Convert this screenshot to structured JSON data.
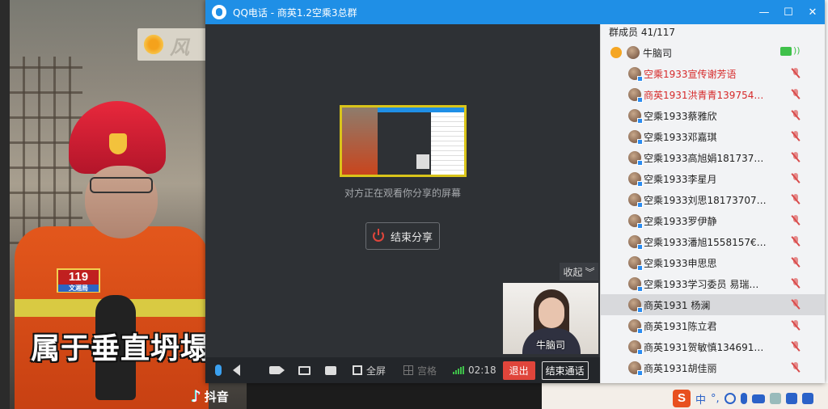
{
  "background_video": {
    "subtitle": "属于垂直坍塌",
    "patch_number": "119",
    "patch_sub": "文湘局",
    "app_name": "抖音"
  },
  "window": {
    "title": "QQ电话 - 商英1.2空乘3总群",
    "controls": [
      "minimize",
      "maximize",
      "close"
    ]
  },
  "share": {
    "status_text": "对方正在观看你分享的屏幕",
    "end_share_label": "结束分享",
    "collapse_label": "收起",
    "pip_name": "牛脑司"
  },
  "toolbar": {
    "fullscreen_label": "全屏",
    "grid_label": "宫格",
    "timer": "02:18",
    "exit_label": "退出",
    "end_call_label": "结束通话"
  },
  "members": {
    "header": "群成员 41/117",
    "me": {
      "name": "牛脑司"
    },
    "list": [
      {
        "name": "空乘1933宣传谢芳语",
        "red": true
      },
      {
        "name": "商英1931洪青青139754…",
        "red": true
      },
      {
        "name": "空乘1933蔡雅欣",
        "red": false
      },
      {
        "name": "空乘1933邓嘉琪",
        "red": false
      },
      {
        "name": "空乘1933高旭娟181737…",
        "red": false
      },
      {
        "name": "空乘1933李星月",
        "red": false
      },
      {
        "name": "空乘1933刘思18173707…",
        "red": false
      },
      {
        "name": "空乘1933罗伊静",
        "red": false
      },
      {
        "name": "空乘1933潘旭1558157€…",
        "red": false
      },
      {
        "name": "空乘1933申思思",
        "red": false
      },
      {
        "name": "空乘1933学习委员 易瑞…",
        "red": false
      },
      {
        "name": "商英1931 杨澜",
        "red": false,
        "selected": true
      },
      {
        "name": "商英1931陈立君",
        "red": false
      },
      {
        "name": "商英1931贺敏慎134691…",
        "red": false
      },
      {
        "name": "商英1931胡佳丽",
        "red": false
      }
    ]
  },
  "ime": {
    "logo": "S",
    "lang": "中",
    "punct": "°,"
  },
  "colors": {
    "titlebar": "#1f8fe6",
    "window_bg": "#2e3135",
    "exit_button": "#e0453b",
    "member_red": "#d62a2a"
  }
}
